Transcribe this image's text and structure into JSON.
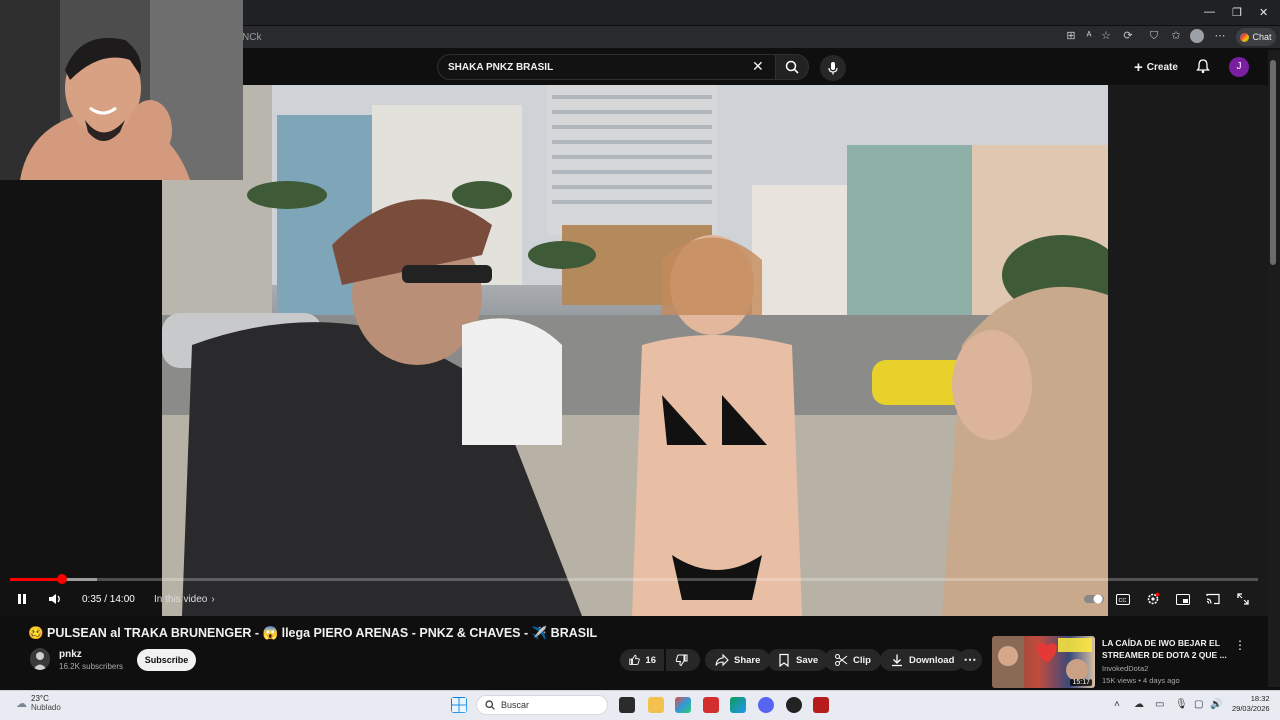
{
  "browser": {
    "url_fragment": "NCk",
    "chat_label": "Chat",
    "profile_initial": "J"
  },
  "youtube": {
    "search_query": "SHAKA PNKZ BRASIL",
    "create_label": "Create",
    "avatar_initial": "J"
  },
  "player": {
    "current_time": "0:35",
    "duration": "14:00",
    "time_display": "0:35 / 14:00",
    "in_video_label": "In this video",
    "progress_fraction": 0.042,
    "buffered_fraction": 0.07,
    "accent_color": "#ff0000"
  },
  "video": {
    "title": "🥴 PULSEAN al TRAKA BRUNENGER - 😱 llega PIERO ARENAS - PNKZ & CHAVES - ✈️ BRASIL",
    "channel": "pnkz",
    "subscribers": "16.2K subscribers",
    "subscribe_label": "Subscribe",
    "likes": "16",
    "share_label": "Share",
    "save_label": "Save",
    "clip_label": "Clip",
    "download_label": "Download"
  },
  "recommendation": {
    "title": "LA CAÍDA DE IWO BEJAR EL STREAMER DE DOTA 2 QUE ...",
    "channel": "InvokedDota2",
    "meta": "15K views • 4 days ago",
    "duration": "15:17"
  },
  "taskbar": {
    "temperature": "23°C",
    "weather": "Nublado",
    "search_placeholder": "Buscar",
    "time": "18:32",
    "date": "29/03/2026"
  }
}
